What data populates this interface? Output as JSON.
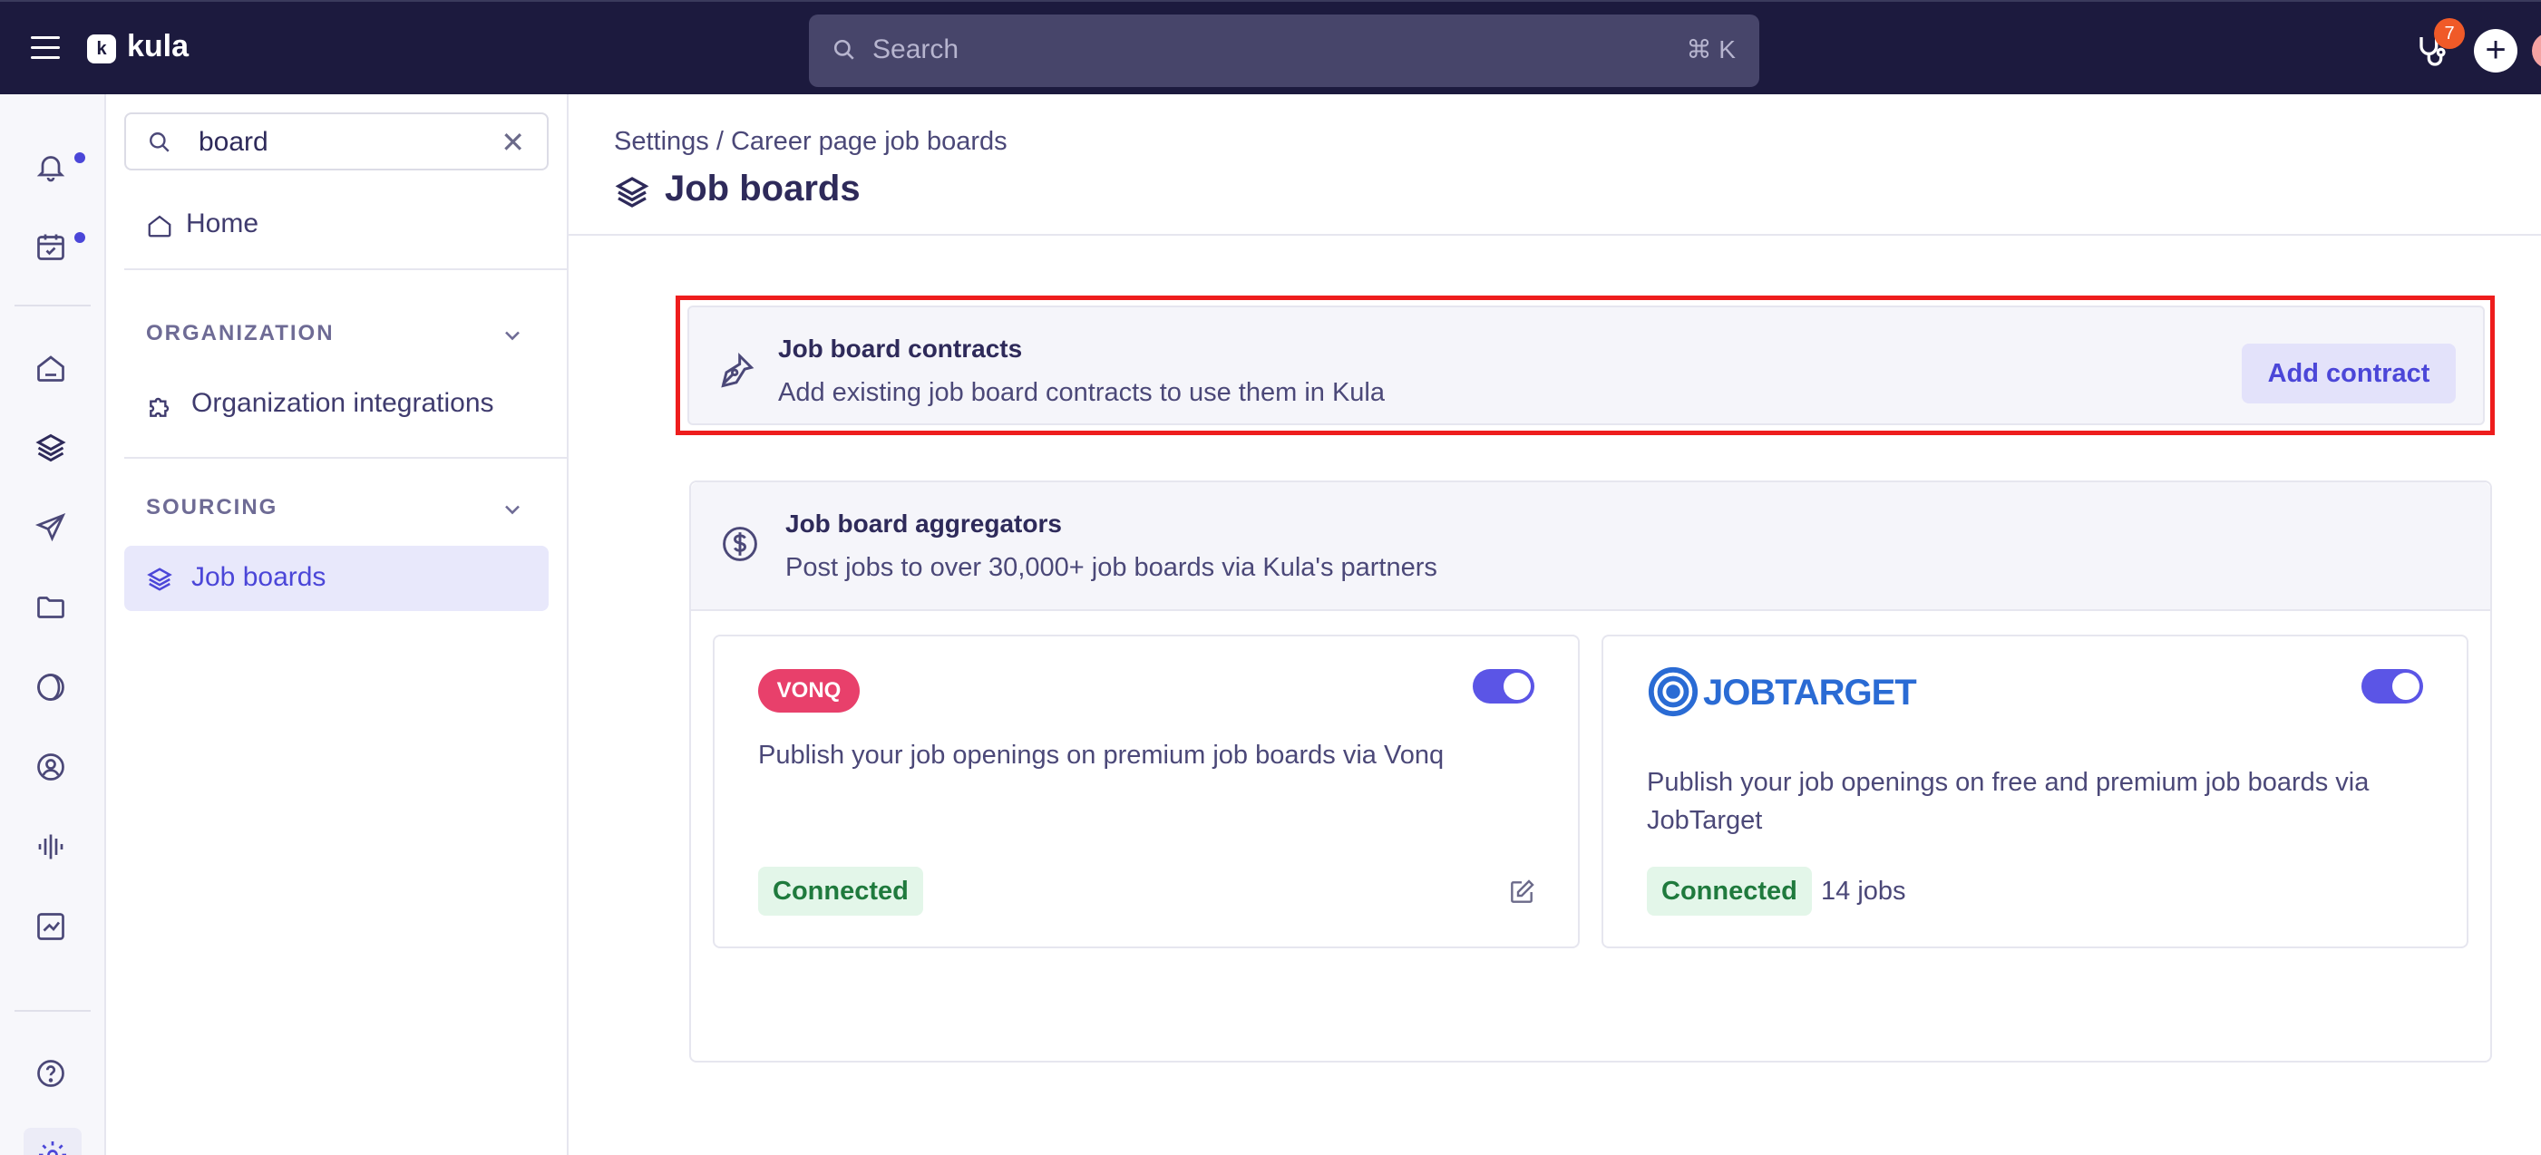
{
  "topbar": {
    "app_name": "kula",
    "logo_glyph": "k",
    "search_placeholder": "Search",
    "search_shortcut": "⌘ K",
    "notification_count": "7",
    "plus_label": "+"
  },
  "rail": {
    "icons": [
      "bell-icon",
      "calendar-icon",
      "home-icon",
      "layers-icon",
      "send-icon",
      "folder-icon",
      "contrast-icon",
      "user-circle-icon",
      "waveform-icon",
      "chart-icon",
      "help-icon",
      "settings-icon"
    ]
  },
  "settings_nav": {
    "search_value": "board",
    "clear_label": "✕",
    "home_label": "Home",
    "organization_heading": "ORGANIZATION",
    "organization_items": [
      "Organization integrations"
    ],
    "sourcing_heading": "SOURCING",
    "sourcing_items": [
      "Job boards"
    ]
  },
  "main": {
    "breadcrumb": "Settings / Career page job boards",
    "title": "Job boards",
    "contracts": {
      "title": "Job board contracts",
      "subtitle": "Add existing job board contracts to use them in Kula",
      "button": "Add contract"
    },
    "aggregators": {
      "title": "Job board aggregators",
      "subtitle": "Post jobs to over 30,000+ job boards via Kula's partners",
      "partners": [
        {
          "logo_text": "VONQ",
          "description": "Publish your job openings on premium job boards via Vonq",
          "status": "Connected",
          "enabled": true
        },
        {
          "logo_text": "JOBTARGET",
          "description": "Publish your job openings on free and premium job boards via JobTarget",
          "status": "Connected",
          "jobs": "14 jobs",
          "enabled": true
        }
      ]
    }
  },
  "colors": {
    "topbar": "#1c1a3e",
    "accent": "#4b46d8",
    "highlight_border": "#ee1d1d",
    "connected_bg": "#e3f6e9",
    "connected_text": "#1f7a3d",
    "vonq_brand": "#e8406b",
    "jobtarget_brand": "#2a6bd4"
  }
}
